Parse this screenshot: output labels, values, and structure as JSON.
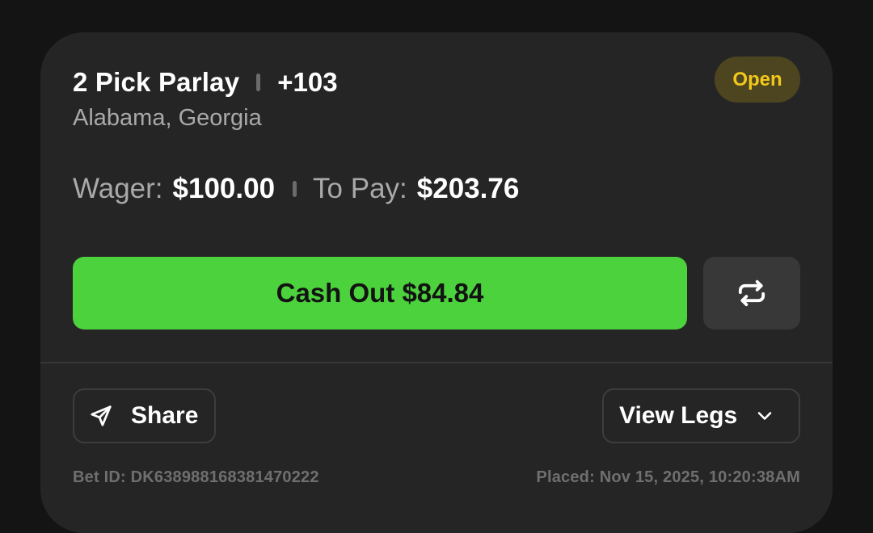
{
  "bet": {
    "title": "2 Pick Parlay",
    "odds": "+103",
    "selections": "Alabama, Georgia",
    "status": "Open"
  },
  "wager": {
    "wager_label": "Wager:",
    "wager_amount": "$100.00",
    "topay_label": "To Pay:",
    "topay_amount": "$203.76"
  },
  "actions": {
    "cashout_label": "Cash Out $84.84",
    "share_label": "Share",
    "view_legs_label": "View Legs"
  },
  "footer": {
    "bet_id": "Bet ID: DK638988168381470222",
    "placed": "Placed: Nov 15, 2025, 10:20:38AM"
  },
  "icons": {
    "refresh": "refresh-icon",
    "share": "send-icon",
    "chevron": "chevron-down-icon"
  },
  "colors": {
    "background": "#141414",
    "card": "#252525",
    "accent_green": "#4cd23c",
    "status_text": "#f2c81b",
    "status_bg": "#4d4520",
    "muted_text": "#a9a9a9"
  }
}
